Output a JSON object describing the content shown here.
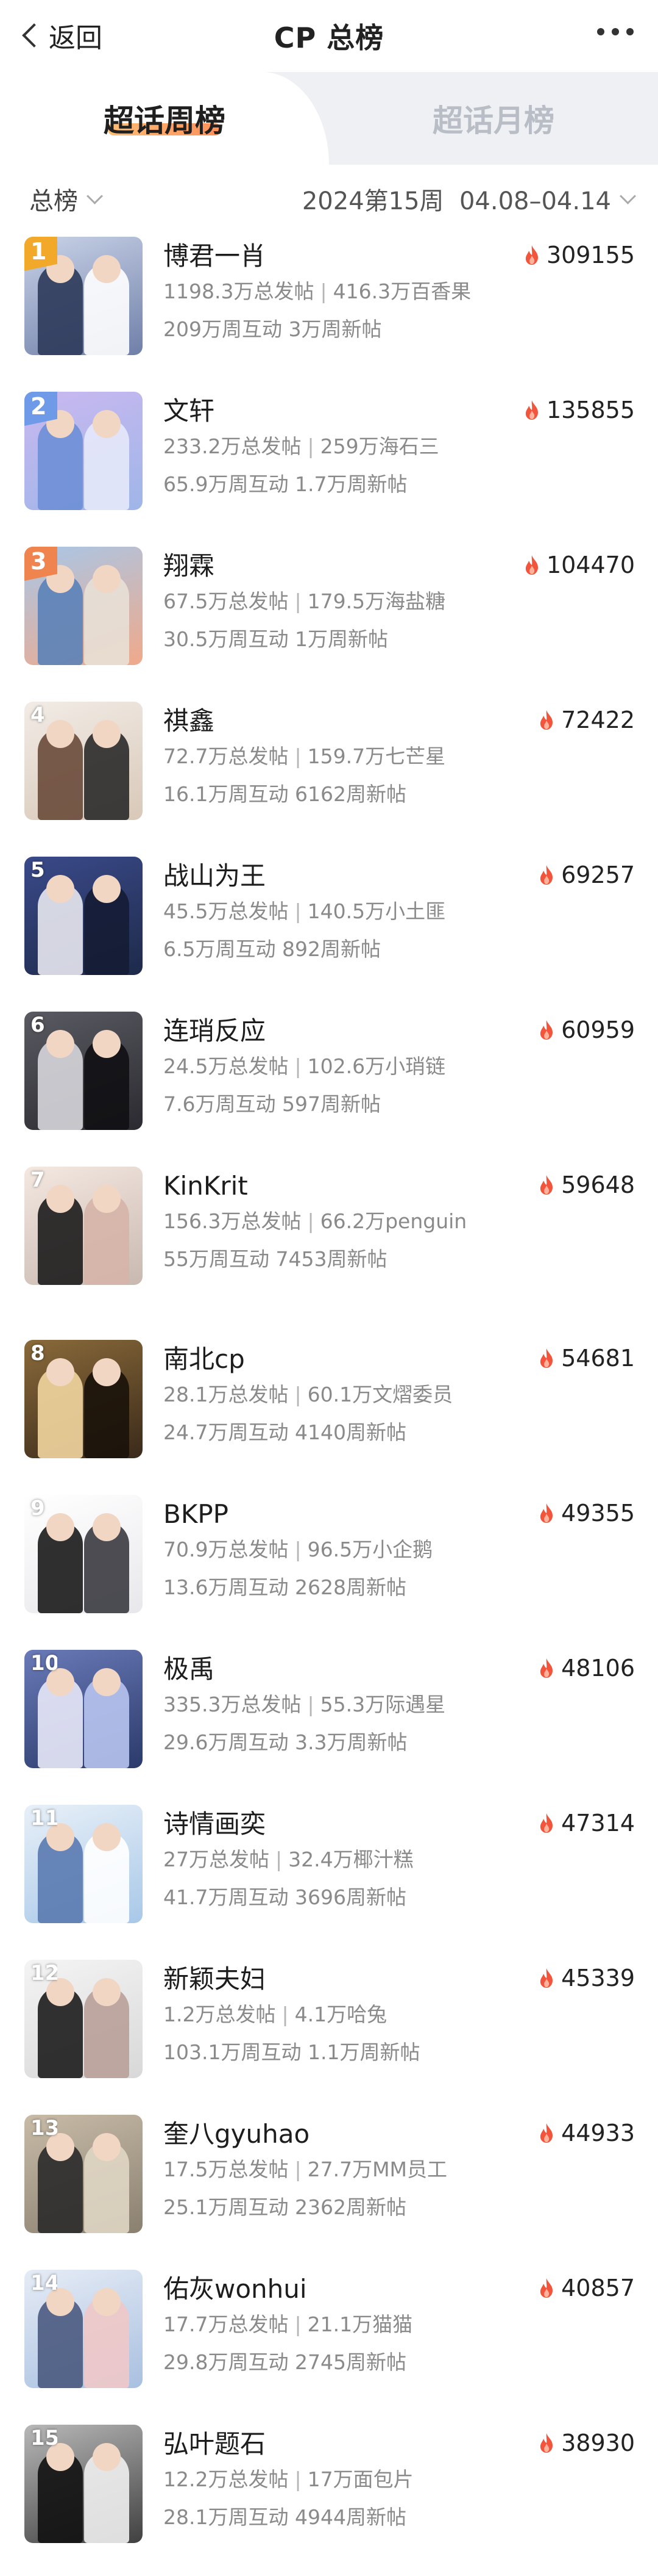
{
  "topbar": {
    "back_label": "返回",
    "title": "CP 总榜"
  },
  "tabs": [
    {
      "label": "超话周榜",
      "active": true
    },
    {
      "label": "超话月榜",
      "active": false
    }
  ],
  "filters": {
    "left": "总榜",
    "right": "2024第15周  04.08–04.14"
  },
  "colors": {
    "accent": "#ff7c3c",
    "flame": "#f2553c"
  },
  "rows": [
    {
      "rank": "1",
      "name": "博君一肖",
      "heat": "309155",
      "posts": "1198.3万总发帖",
      "fans": "416.3万百香果",
      "interact": "209万周互动",
      "new_posts": "3万周新帖"
    },
    {
      "rank": "2",
      "name": "文轩",
      "heat": "135855",
      "posts": "233.2万总发帖",
      "fans": "259万海石三",
      "interact": "65.9万周互动",
      "new_posts": "1.7万周新帖"
    },
    {
      "rank": "3",
      "name": "翔霖",
      "heat": "104470",
      "posts": "67.5万总发帖",
      "fans": "179.5万海盐糖",
      "interact": "30.5万周互动",
      "new_posts": "1万周新帖"
    },
    {
      "rank": "4",
      "name": "祺鑫",
      "heat": "72422",
      "posts": "72.7万总发帖",
      "fans": "159.7万七芒星",
      "interact": "16.1万周互动",
      "new_posts": "6162周新帖"
    },
    {
      "rank": "5",
      "name": "战山为王",
      "heat": "69257",
      "posts": "45.5万总发帖",
      "fans": "140.5万小土匪",
      "interact": "6.5万周互动",
      "new_posts": "892周新帖"
    },
    {
      "rank": "6",
      "name": "连琑反应",
      "heat": "60959",
      "posts": "24.5万总发帖",
      "fans": "102.6万小琑链",
      "interact": "7.6万周互动",
      "new_posts": "597周新帖"
    },
    {
      "rank": "7",
      "name": "KinKrit",
      "heat": "59648",
      "posts": "156.3万总发帖",
      "fans": "66.2万penguin",
      "interact": "55万周互动",
      "new_posts": "7453周新帖"
    },
    {
      "rank": "8",
      "name": "南北cp",
      "heat": "54681",
      "posts": "28.1万总发帖",
      "fans": "60.1万文熠委员",
      "interact": "24.7万周互动",
      "new_posts": "4140周新帖"
    },
    {
      "rank": "9",
      "name": "BKPP",
      "heat": "49355",
      "posts": "70.9万总发帖",
      "fans": "96.5万小企鹅",
      "interact": "13.6万周互动",
      "new_posts": "2628周新帖"
    },
    {
      "rank": "10",
      "name": "极禹",
      "heat": "48106",
      "posts": "335.3万总发帖",
      "fans": "55.3万际遇星",
      "interact": "29.6万周互动",
      "new_posts": "3.3万周新帖"
    },
    {
      "rank": "11",
      "name": "诗情画奕",
      "heat": "47314",
      "posts": "27万总发帖",
      "fans": "32.4万椰汁糕",
      "interact": "41.7万周互动",
      "new_posts": "3696周新帖"
    },
    {
      "rank": "12",
      "name": "新颖夫妇",
      "heat": "45339",
      "posts": "1.2万总发帖",
      "fans": "4.1万哈兔",
      "interact": "103.1万周互动",
      "new_posts": "1.1万周新帖"
    },
    {
      "rank": "13",
      "name": "奎八gyuhao",
      "heat": "44933",
      "posts": "17.5万总发帖",
      "fans": "27.7万MM员工",
      "interact": "25.1万周互动",
      "new_posts": "2362周新帖"
    },
    {
      "rank": "14",
      "name": "佑灰wonhui",
      "heat": "40857",
      "posts": "17.7万总发帖",
      "fans": "21.1万猫猫",
      "interact": "29.8万周互动",
      "new_posts": "2745周新帖"
    },
    {
      "rank": "15",
      "name": "弘叶题石",
      "heat": "38930",
      "posts": "12.2万总发帖",
      "fans": "17万面包片",
      "interact": "28.1万周互动",
      "new_posts": "4944周新帖"
    }
  ]
}
